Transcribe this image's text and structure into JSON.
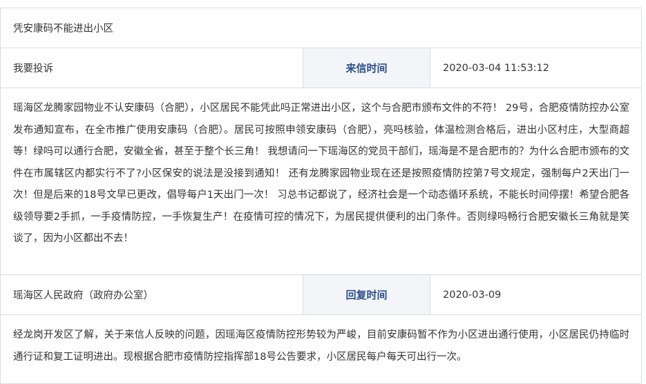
{
  "letter": {
    "title": "凭安康码不能进出小区",
    "type": "我要投诉",
    "sent_label": "来信时间",
    "sent_time": "2020-03-04 11:53:12",
    "content": "瑶海区龙腾家园物业不认安康码（合肥），小区居民不能凭此吗正常进出小区，这个与合肥市颁布文件的不符！ 29号，合肥疫情防控办公室发布通知宣布，在全市推广使用安康码（合肥）。居民可按照申领安康码（合肥），亮吗核验，体温检测合格后，进出小区村庄，大型商超等！绿吗可以通行合肥，安徽全省，甚至于整个长三角！ 我想请问一下瑶海区的党员干部们，瑶海是不是合肥市的？为什么合肥市颁布的文件在市属辖区内都实行不了?小区保安的说法是没接到通知！ 还有龙腾家园物业现在还是按照疫情防控第7号文规定，强制每户2天出门一次！但是后来的18号文早已更改，倡导每户1天出门一次！ 习总书记都说了，经济社会是一个动态循环系统，不能长时间停摆！希望合肥各级领导要2手抓，一手疫情防控，一手恢复生产！在疫情可控的情况下，为居民提供便利的出门条件。否则绿吗畅行合肥安徽长三角就是笑谈了，因为小区都出不去！"
  },
  "reply": {
    "department": "瑶海区人民政府（政府办公室）",
    "reply_label": "回复时间",
    "reply_time": "2020-03-09",
    "content": "经龙岗开发区了解，关于来信人反映的问题，因瑶海区疫情防控形势较为严峻，目前安康码暂不作为小区进出通行使用，小区居民仍持临时通行证和复工证明进出。现根据合肥市疫情防控指挥部18号公告要求，小区居民每户每天可出行一次。"
  },
  "colors": {
    "border": "#d6dde6",
    "label_background": "#f4f5f9",
    "label_text": "#2c4f8a",
    "body_text": "#333333"
  }
}
